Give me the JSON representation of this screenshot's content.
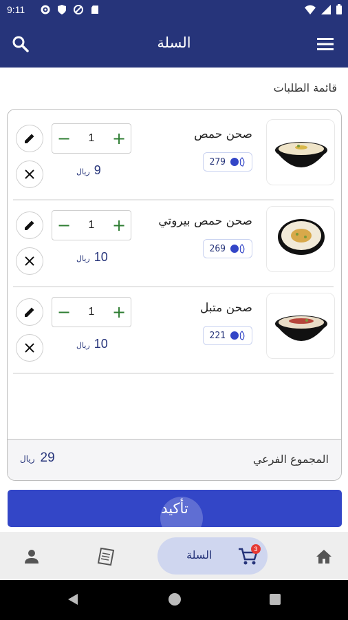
{
  "status": {
    "time": "9:11"
  },
  "appbar": {
    "title": "السلة"
  },
  "section_title": "قائمة الطلبات",
  "items": [
    {
      "name": "صحن حمص",
      "calories": "279",
      "quantity": "1",
      "price": "9",
      "currency": "ريال"
    },
    {
      "name": "صحن حمص بيروتي",
      "calories": "269",
      "quantity": "1",
      "price": "10",
      "currency": "ريال"
    },
    {
      "name": "صحن متبل",
      "calories": "221",
      "quantity": "1",
      "price": "10",
      "currency": "ريال"
    }
  ],
  "subtotal": {
    "label": "المجموع الفرعي",
    "amount": "29",
    "currency": "ريال"
  },
  "confirm_label": "تأكيد",
  "bottom_nav": {
    "cart_label": "السلة",
    "cart_badge": "3"
  },
  "colors": {
    "primary": "#26347a",
    "button": "#3346c7",
    "plus_minus": "#2e7d32",
    "badge": "#e53935"
  },
  "icons": [
    "search-icon",
    "menu-icon",
    "edit-icon",
    "close-icon",
    "calorie-icon",
    "home-icon",
    "cart-icon",
    "receipt-icon",
    "person-icon"
  ]
}
